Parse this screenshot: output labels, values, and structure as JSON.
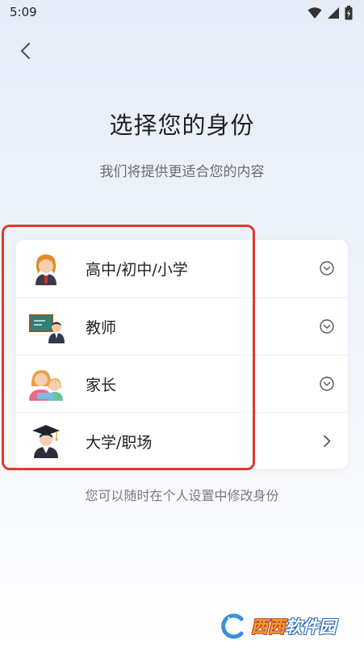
{
  "status_bar": {
    "time": "5:09"
  },
  "header": {
    "title": "选择您的身份",
    "subtitle": "我们将提供更适合您的内容"
  },
  "options": [
    {
      "label": "高中/初中/小学",
      "icon": "student-girl-avatar",
      "indicator": "chevron-down-circle"
    },
    {
      "label": "教师",
      "icon": "teacher-blackboard-avatar",
      "indicator": "chevron-down-circle"
    },
    {
      "label": "家长",
      "icon": "parent-child-avatar",
      "indicator": "chevron-down-circle"
    },
    {
      "label": "大学/职场",
      "icon": "graduate-cap-avatar",
      "indicator": "chevron-right"
    }
  ],
  "footer": {
    "hint": "您可以随时在个人设置中修改身份"
  },
  "watermark": {
    "text_a": "西西",
    "text_b": "软件园"
  },
  "colors": {
    "highlight": "#e03a2c",
    "text_primary": "#222222",
    "text_secondary": "#6b6b6b"
  }
}
